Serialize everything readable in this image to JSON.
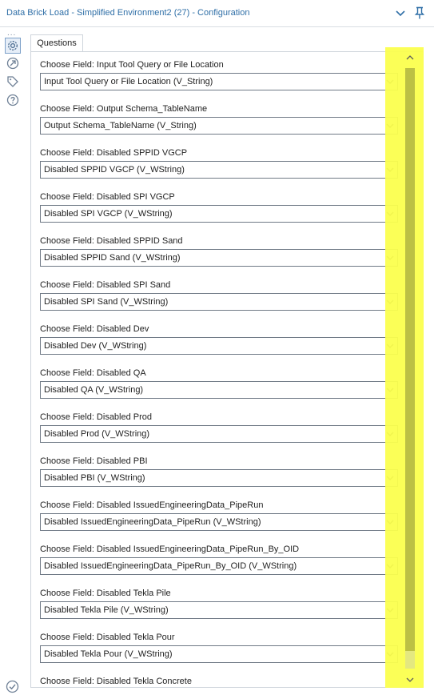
{
  "window": {
    "title": "Data Brick Load - Simplified Environment2 (27) - Configuration",
    "accent_color": "#2f6fa7",
    "dots": "..."
  },
  "sidebar": {
    "icons": [
      "gear-icon",
      "connection-icon",
      "tag-icon",
      "help-icon"
    ],
    "status_icon": "check-circle-icon"
  },
  "tabs": [
    {
      "label": "Questions"
    }
  ],
  "questions": [
    {
      "label": "Choose Field: Input Tool Query or File Location",
      "value": "Input Tool Query or File Location (V_String)"
    },
    {
      "label": "Choose Field: Output Schema_TableName",
      "value": "Output Schema_TableName (V_String)"
    },
    {
      "label": "Choose Field: Disabled SPPID VGCP",
      "value": "Disabled SPPID VGCP (V_WString)"
    },
    {
      "label": "Choose Field: Disabled SPI VGCP",
      "value": "Disabled SPI VGCP (V_WString)"
    },
    {
      "label": "Choose Field: Disabled SPPID Sand",
      "value": "Disabled SPPID Sand (V_WString)"
    },
    {
      "label": "Choose Field: Disabled SPI Sand",
      "value": "Disabled SPI Sand (V_WString)"
    },
    {
      "label": "Choose Field: Disabled Dev",
      "value": "Disabled Dev (V_WString)"
    },
    {
      "label": "Choose Field: Disabled QA",
      "value": "Disabled QA (V_WString)"
    },
    {
      "label": "Choose Field: Disabled Prod",
      "value": "Disabled Prod (V_WString)"
    },
    {
      "label": "Choose Field: Disabled PBI",
      "value": "Disabled PBI (V_WString)"
    },
    {
      "label": "Choose Field: Disabled IssuedEngineeringData_PipeRun",
      "value": "Disabled IssuedEngineeringData_PipeRun (V_WString)"
    },
    {
      "label": "Choose Field: Disabled IssuedEngineeringData_PipeRun_By_OID",
      "value": "Disabled IssuedEngineeringData_PipeRun_By_OID (V_WString)"
    },
    {
      "label": "Choose Field: Disabled Tekla Pile",
      "value": "Disabled Tekla Pile (V_WString)"
    },
    {
      "label": "Choose Field: Disabled Tekla Pour",
      "value": "Disabled Tekla Pour (V_WString)"
    },
    {
      "label": "Choose Field: Disabled Tekla Concrete",
      "value": ""
    }
  ],
  "scrollbar": {
    "highlight_color": "#fbff4f",
    "position_fraction": 0.0
  }
}
